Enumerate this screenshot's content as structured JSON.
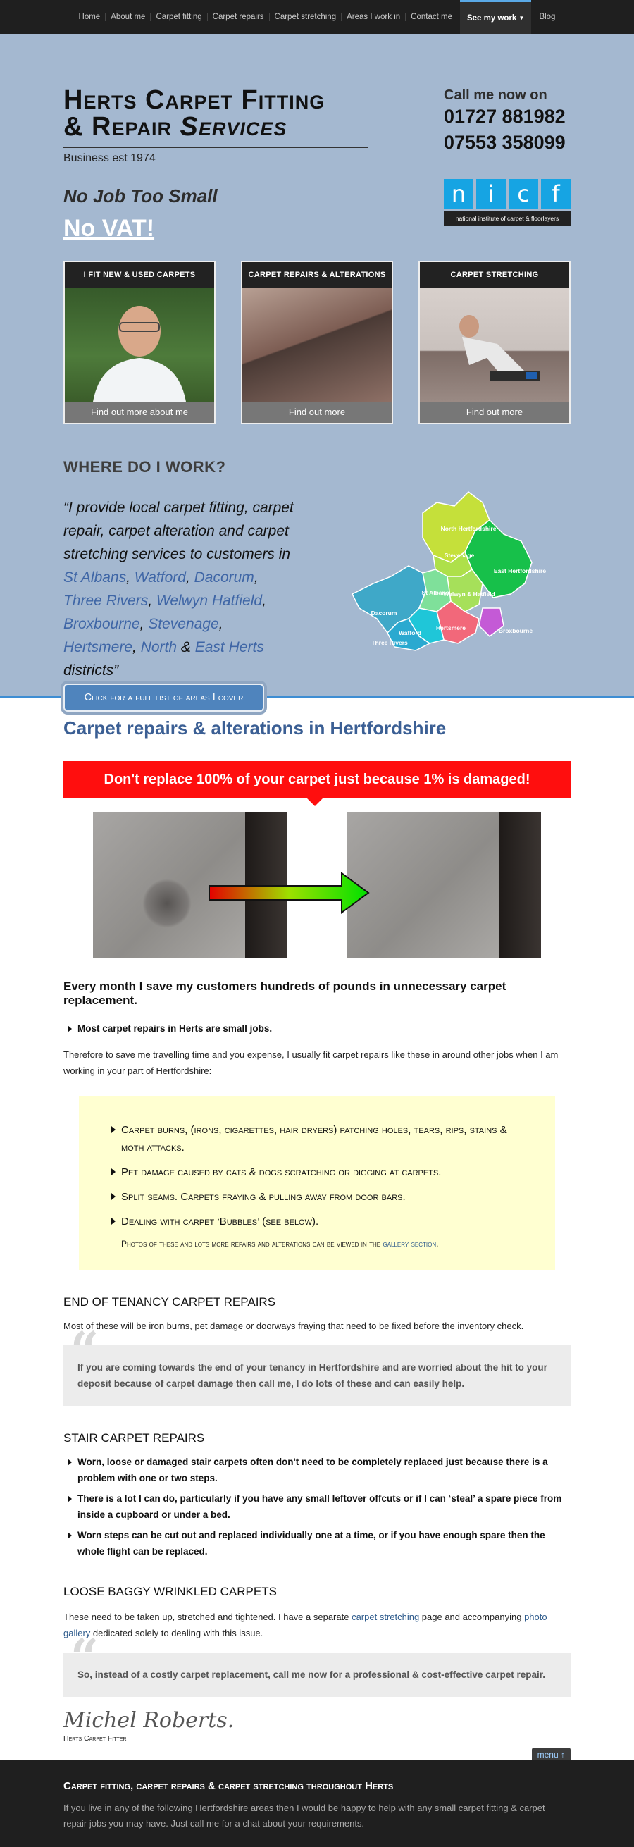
{
  "nav": {
    "items": [
      "Home",
      "About me",
      "Carpet fitting",
      "Carpet repairs",
      "Carpet stretching",
      "Areas I work in",
      "Contact me"
    ],
    "active": "See my work",
    "last": "Blog"
  },
  "hero": {
    "title_line1": "Herts Carpet Fitting",
    "title_line2a": "& Repair ",
    "title_line2b": "Services",
    "est": "Business est 1974",
    "tagline": "No Job Too Small",
    "novat": "No VAT!",
    "call_label": "Call me now on",
    "phone1": "01727 881982",
    "phone2": "07553 358099",
    "nicf_letters": [
      "n",
      "i",
      "c",
      "f"
    ],
    "nicf_strap": "national institute of carpet & floorlayers",
    "cards": [
      {
        "title": "I FIT NEW & USED CARPETS",
        "cta": "Find out more about me"
      },
      {
        "title": "CARPET REPAIRS & ALTERATIONS",
        "cta": "Find out more"
      },
      {
        "title": "CARPET STRETCHING",
        "cta": "Find out more"
      }
    ],
    "where": "WHERE DO I WORK?",
    "quote_pre": "“I provide local carpet fitting, carpet repair, carpet alteration and carpet stretching services to customers in ",
    "quote_links": [
      "St Albans",
      "Watford",
      "Dacorum",
      "Three Rivers",
      "Welwyn Hatfield",
      "Broxbourne",
      "Stevenage",
      "Hertsmere",
      "North",
      "East Herts"
    ],
    "quote_post": " districts”",
    "map_labels": [
      "North Hertfordshire",
      "Stevenage",
      "East Hertfordshire",
      "Dacorum",
      "St Albans",
      "Welwyn & Hatfield",
      "Broxbourne",
      "Hertsmere",
      "Watford",
      "Three Rivers"
    ],
    "areas_button": "Click for a full list of areas I cover"
  },
  "main": {
    "heading": "Carpet repairs & alterations in Hertfordshire",
    "banner": "Don't replace 100% of your carpet just because 1% is damaged!",
    "lead": "Every month I save my customers hundreds of pounds in unnecessary carpet replacement.",
    "bullet1": "Most carpet repairs in Herts are small jobs.",
    "para1": "Therefore to save me travelling time and you expense, I usually fit carpet repairs like these in around other jobs when I am working in your part of Hertfordshire:",
    "yellow_items": [
      "Carpet burns, (irons, cigarettes, hair dryers) patching holes, tears, rips, stains & moth attacks.",
      "Pet damage caused by cats & dogs scratching or digging at carpets.",
      "Split seams. Carpets fraying & pulling away from door bars.",
      "Dealing with carpet ‘Bubbles’ (see below)."
    ],
    "yellow_note_pre": "Photos of these and lots more repairs and alterations can be viewed in the ",
    "yellow_note_link": "gallery section",
    "yellow_note_post": ".",
    "eot_heading": "END OF TENANCY CARPET REPAIRS",
    "eot_para": "Most of these will be iron burns, pet damage or doorways fraying that need to be fixed before the inventory check.",
    "eot_callout": "If you are coming towards the end of your tenancy in Hertfordshire and are worried about the hit to your deposit because of carpet damage then call me, I do lots of these and can easily help.",
    "stair_heading": "STAIR CARPET REPAIRS",
    "stair_items": [
      "Worn, loose or damaged stair carpets often don't need to be completely replaced just because there is a problem with one or two steps.",
      "There is a lot I can do, particularly if you have any small leftover offcuts or if I can ‘steal’ a spare piece from inside a cupboard or under a bed.",
      "Worn steps can be cut out and replaced individually one at a time, or if you have enough spare then the whole flight can be replaced."
    ],
    "loose_heading": "LOOSE BAGGY WRINKLED CARPETS",
    "loose_pre": "These need to be taken up, stretched and tightened. I have a separate ",
    "loose_link1": "carpet stretching",
    "loose_mid": " page and accompanying ",
    "loose_link2": "photo gallery",
    "loose_post": " dedicated solely to dealing with this issue.",
    "loose_callout": "So, instead of a costly carpet replacement, call me now for a professional & cost-effective carpet repair.",
    "signature": "Michel Roberts.",
    "sig_title": "Herts Carpet Fitter"
  },
  "menu_tab": "menu ↑",
  "footer": {
    "heading": "Carpet fitting, carpet repairs & carpet stretching throughout Herts",
    "text": "If you live in any of the following Hertfordshire areas then I would be happy to help with any small carpet fitting & carpet repair jobs you may have. Just call me for a chat about your requirements."
  }
}
